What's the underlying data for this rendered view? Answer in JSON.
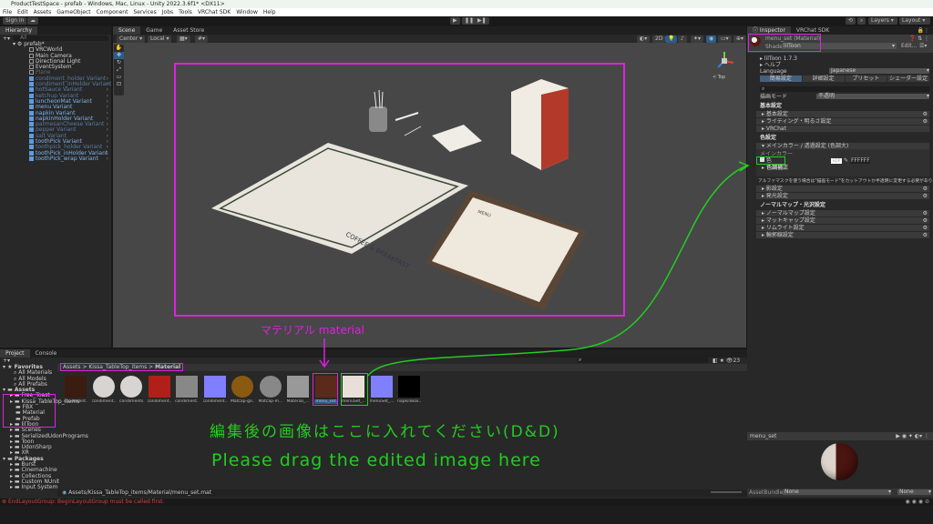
{
  "window": {
    "title": "ProductTestSpace - prefab - Windows, Mac, Linux - Unity 2022.3.6f1* <DX11>"
  },
  "menu": [
    "File",
    "Edit",
    "Assets",
    "GameObject",
    "Component",
    "Services",
    "Jobs",
    "Tools",
    "VRChat SDK",
    "Window",
    "Help"
  ],
  "toolbar": {
    "sign_in": "Sign in",
    "layers": "Layers",
    "layout": "Layout"
  },
  "hierarchy": {
    "tab": "Hierarchy",
    "search_placeholder": "All",
    "root": "prefab*",
    "items": [
      {
        "label": "VRCWorld",
        "style": "normal"
      },
      {
        "label": "Main Camera",
        "style": "normal"
      },
      {
        "label": "Directional Light",
        "style": "normal"
      },
      {
        "label": "EventSystem",
        "style": "normal"
      },
      {
        "label": "Plane",
        "style": "grey"
      },
      {
        "label": "condiment_holder Variant",
        "style": "dim"
      },
      {
        "label": "condiment_inHolder Variant",
        "style": "dim"
      },
      {
        "label": "hotSauce Variant",
        "style": "dim"
      },
      {
        "label": "ketchup Variant",
        "style": "dim"
      },
      {
        "label": "luncheonMat Variant",
        "style": "blue"
      },
      {
        "label": "menu Variant",
        "style": "blue"
      },
      {
        "label": "napkin Variant",
        "style": "blue"
      },
      {
        "label": "napkinHolder Variant",
        "style": "blue"
      },
      {
        "label": "parmesanCheese Variant",
        "style": "dim"
      },
      {
        "label": "pepper Variant",
        "style": "dim"
      },
      {
        "label": "salt Variant",
        "style": "dim"
      },
      {
        "label": "toothPick Variant",
        "style": "blue"
      },
      {
        "label": "toothpick_holder Variant",
        "style": "dim"
      },
      {
        "label": "toothPick_inHolder Variant",
        "style": "blue"
      },
      {
        "label": "toothPick_wrap Variant",
        "style": "blue"
      }
    ]
  },
  "scene": {
    "tabs": [
      "Scene",
      "Game",
      "Asset Store"
    ],
    "pivot": "Center",
    "space": "Local",
    "gizmo_label": "< Top",
    "props": {
      "mat_text": "COFFEE & BREAKFAST",
      "menu_title": "MENU"
    }
  },
  "inspector": {
    "tabs": [
      "Inspector",
      "VRChat SDK"
    ],
    "object": "menu_set (Material)",
    "shader_label": "Shader",
    "shader": "lilToon",
    "edit_btn": "Edit...",
    "version": "lilToon 1.7.3",
    "help": "ヘルプ",
    "language_label": "Language",
    "language": "Japanese",
    "mode_tabs": [
      "簡易設定",
      "詳細設定",
      "プリセット",
      "シェーダー設定"
    ],
    "render_mode_label": "描画モード",
    "render_mode": "不透明",
    "basic_header": "基本設定",
    "basic_items": [
      "基本設定",
      "ライティング・明るさ設定",
      "VRChat"
    ],
    "color_header": "色設定",
    "main_color_fold": "メインカラー / 透過設定 (色調大)",
    "main_color_label": "メインカラー",
    "color_field": "色",
    "hdr": "HDR",
    "hex": "FFFFFF",
    "tone": "色調補正",
    "alpha_note": "アルファマスクを使う場合は\"描画モード\"をカットアウトか半透明に変更する必要があります。",
    "color_items": [
      "影設定",
      "発光設定"
    ],
    "normal_header": "ノーマルマップ・光沢設定",
    "normal_items": [
      "ノーマルマップ設定",
      "マットキャップ設定",
      "リムライト設定",
      "輪郭線設定"
    ],
    "preview_name": "menu_set",
    "assetbundle_label": "AssetBundle",
    "assetbundle": "None",
    "variant": "None"
  },
  "project": {
    "tabs": [
      "Project",
      "Console"
    ],
    "count": "23",
    "favorites": {
      "label": "Favorites",
      "items": [
        "All Materials",
        "All Models",
        "All Prefabs"
      ]
    },
    "assets": {
      "label": "Assets",
      "items": [
        {
          "label": "Free_Toast",
          "d": 1
        },
        {
          "label": "Kissa_TableTop_items",
          "d": 1
        },
        {
          "label": "FBX",
          "d": 2
        },
        {
          "label": "Material",
          "d": 2
        },
        {
          "label": "Prefab",
          "d": 2
        },
        {
          "label": "lilToon",
          "d": 1
        },
        {
          "label": "Scenes",
          "d": 1
        },
        {
          "label": "SerializedUdonPrograms",
          "d": 1
        },
        {
          "label": "Toon",
          "d": 1
        },
        {
          "label": "UdonSharp",
          "d": 1
        },
        {
          "label": "XR",
          "d": 1
        }
      ]
    },
    "packages": {
      "label": "Packages",
      "items": [
        "Burst",
        "Cinemachine",
        "Collections",
        "Custom NUnit",
        "Input System"
      ]
    },
    "breadcrumb": [
      "Assets",
      "Kissa_TableTop_items",
      "Material"
    ],
    "assets_grid": [
      {
        "label": "condiment...",
        "color": "#3a1c10"
      },
      {
        "label": "condiment...",
        "color": "#d8d4d2"
      },
      {
        "label": "condiments",
        "color": "#d8d4d2"
      },
      {
        "label": "condiment...",
        "color": "#b02018"
      },
      {
        "label": "condiment...",
        "color": "#888888"
      },
      {
        "label": "condiment...",
        "color": "#7f7fff"
      },
      {
        "label": "Matcap-go...",
        "color": "#8a5a10"
      },
      {
        "label": "Matcap-m...",
        "color": "#888888"
      },
      {
        "label": "Material_...",
        "color": "#999999"
      },
      {
        "label": "menu_set",
        "color": "#5a2a1a"
      },
      {
        "label": "menuSet_...",
        "color": "#e8e0d8"
      },
      {
        "label": "menuSet_...",
        "color": "#8080ff"
      },
      {
        "label": "napkinBox...",
        "color": "#000000"
      }
    ],
    "selected": "menu_set",
    "path": "Assets/Kissa_TableTop_items/Material/menu_set.mat"
  },
  "status": {
    "error": "EndLayoutGroup: BeginLayoutGroup must be called first."
  },
  "annotations": {
    "material": "マテリアル material",
    "jp": "編集後の画像はここに入れてください(D&D)",
    "en": "Please drag the edited image here"
  },
  "colors": {
    "magenta": "#e020e0",
    "green": "#22cc22",
    "accent": "#2c5d87"
  }
}
